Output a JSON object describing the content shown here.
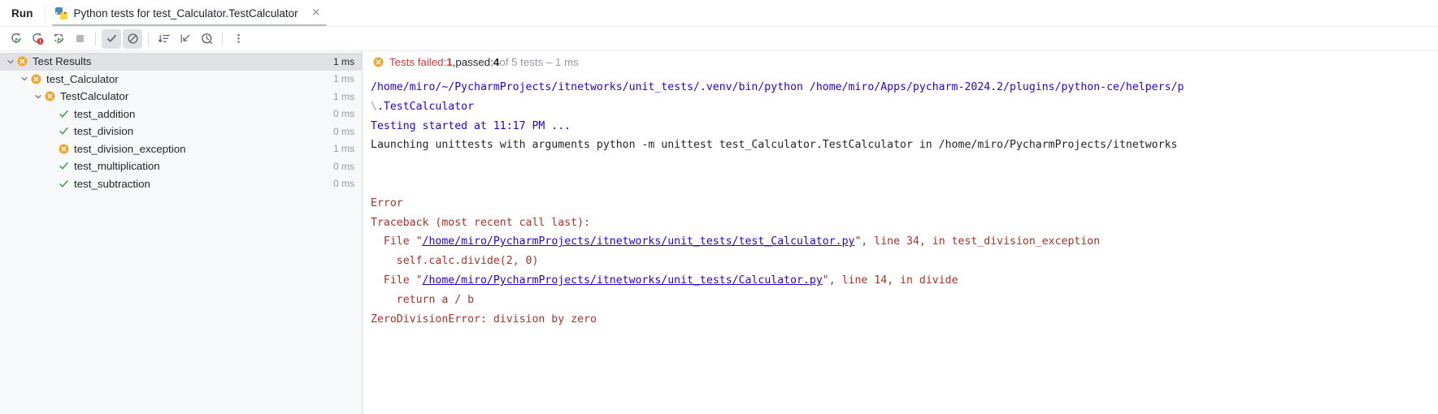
{
  "window": {
    "run_label": "Run"
  },
  "tab": {
    "icon": "python-test-icon",
    "title": "Python tests for test_Calculator.TestCalculator",
    "close_icon": "close-icon"
  },
  "toolbar": {
    "buttons": [
      {
        "name": "rerun-tests-icon",
        "tooltip": "Rerun Tests"
      },
      {
        "name": "rerun-failed-tests-icon",
        "tooltip": "Rerun Failed Tests"
      },
      {
        "name": "toggle-auto-test-icon",
        "tooltip": "Toggle auto-test"
      },
      {
        "name": "stop-icon",
        "tooltip": "Stop"
      },
      {
        "name": "show-passed-icon",
        "tooltip": "Show Passed",
        "pressed": true
      },
      {
        "name": "show-ignored-icon",
        "tooltip": "Show Ignored",
        "pressed": true
      },
      {
        "name": "sort-by-duration-icon",
        "tooltip": "Sort by Duration"
      },
      {
        "name": "expand-collapse-icon",
        "tooltip": "Collapse All"
      },
      {
        "name": "history-icon",
        "tooltip": "Test History"
      },
      {
        "name": "more-options-icon",
        "tooltip": "More Options"
      }
    ]
  },
  "tree": {
    "rows": [
      {
        "label": "Test Results",
        "time": "1 ms",
        "indent": 0,
        "status": "failed",
        "chevron": "down",
        "selected": true
      },
      {
        "label": "test_Calculator",
        "time": "1 ms",
        "indent": 1,
        "status": "failed",
        "chevron": "down",
        "selected": false
      },
      {
        "label": "TestCalculator",
        "time": "1 ms",
        "indent": 2,
        "status": "failed",
        "chevron": "down",
        "selected": false
      },
      {
        "label": "test_addition",
        "time": "0 ms",
        "indent": 3,
        "status": "passed",
        "chevron": "none",
        "selected": false
      },
      {
        "label": "test_division",
        "time": "0 ms",
        "indent": 3,
        "status": "passed",
        "chevron": "none",
        "selected": false
      },
      {
        "label": "test_division_exception",
        "time": "1 ms",
        "indent": 3,
        "status": "failed",
        "chevron": "none",
        "selected": false
      },
      {
        "label": "test_multiplication",
        "time": "0 ms",
        "indent": 3,
        "status": "passed",
        "chevron": "none",
        "selected": false
      },
      {
        "label": "test_subtraction",
        "time": "0 ms",
        "indent": 3,
        "status": "passed",
        "chevron": "none",
        "selected": false
      }
    ]
  },
  "summary": {
    "icon": "failed-icon",
    "failed_label": "Tests failed: ",
    "failed_count": "1",
    "comma": ", ",
    "passed_label": "passed: ",
    "passed_count": "4",
    "of_tests": " of 5 tests – 1 ms"
  },
  "console": {
    "lines": [
      {
        "type": "mixed",
        "parts": [
          {
            "text": "/home/miro/~/PycharmProjects/itnetworks/unit_tests/.venv/bin/python /home/miro/Apps/pycharm-2024.2/plugins/python-ce/helpers/p",
            "style": "blue"
          }
        ]
      },
      {
        "type": "mixed",
        "parts": [
          {
            "text": "\\",
            "style": "gray"
          },
          {
            "text": ".TestCalculator",
            "style": "blue"
          }
        ]
      },
      {
        "type": "mixed",
        "parts": [
          {
            "text": "Testing started at 11:17 PM ...",
            "style": "blue"
          }
        ]
      },
      {
        "type": "mixed",
        "parts": [
          {
            "text": "Launching unittests with arguments python -m unittest test_Calculator.TestCalculator in /home/miro/PycharmProjects/itnetworks",
            "style": "black"
          }
        ]
      },
      {
        "type": "blank"
      },
      {
        "type": "blank"
      },
      {
        "type": "mixed",
        "parts": [
          {
            "text": "Error",
            "style": "red"
          }
        ]
      },
      {
        "type": "mixed",
        "parts": [
          {
            "text": "Traceback (most recent call last):",
            "style": "red"
          }
        ]
      },
      {
        "type": "mixed",
        "parts": [
          {
            "text": "  File \"",
            "style": "red"
          },
          {
            "text": "/home/miro/PycharmProjects/itnetworks/unit_tests/test_Calculator.py",
            "style": "link"
          },
          {
            "text": "\", line 34, in test_division_exception",
            "style": "red"
          }
        ]
      },
      {
        "type": "mixed",
        "parts": [
          {
            "text": "    self.calc.divide(2, 0)",
            "style": "red"
          }
        ]
      },
      {
        "type": "mixed",
        "parts": [
          {
            "text": "  File \"",
            "style": "red"
          },
          {
            "text": "/home/miro/PycharmProjects/itnetworks/unit_tests/Calculator.py",
            "style": "link"
          },
          {
            "text": "\", line 14, in divide",
            "style": "red"
          }
        ]
      },
      {
        "type": "mixed",
        "parts": [
          {
            "text": "    return a / b",
            "style": "red"
          }
        ]
      },
      {
        "type": "mixed",
        "parts": [
          {
            "text": "ZeroDivisionError: division by zero",
            "style": "red"
          }
        ]
      }
    ]
  },
  "colors": {
    "failed_orange": "#f5a623",
    "passed_green": "#4caf50",
    "error_red": "#a5332c",
    "link_blue": "#2a00d1",
    "selection_gray": "#dfe1e5",
    "tree_bg": "#f7f8fa"
  }
}
